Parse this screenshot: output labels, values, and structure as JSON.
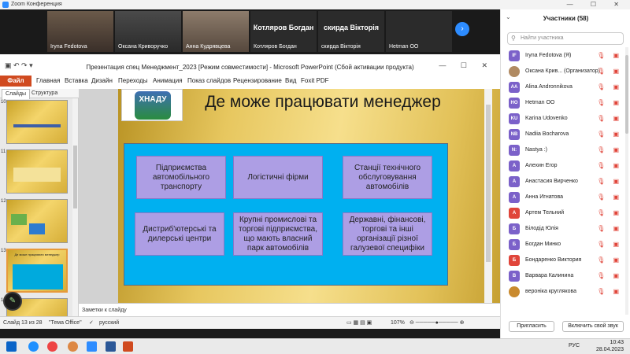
{
  "zoom": {
    "window_title": "Zoom Конференция",
    "video_tiles": [
      {
        "name": "Iryna Fedotova",
        "big": ""
      },
      {
        "name": "Оксана Криворучко",
        "big": ""
      },
      {
        "name": "Анна Кудрявцева",
        "big": ""
      },
      {
        "name": "Котляров Богдан",
        "big": "Котляров Богдан"
      },
      {
        "name": "скирда Вікторія",
        "big": "скирда Вікторія"
      },
      {
        "name": "Hetman OO",
        "big": ""
      }
    ]
  },
  "powerpoint": {
    "title": "Презентация спец Менеджмент_2023 [Режим совместимости] - Microsoft PowerPoint (Сбой активации продукта)",
    "file_tab": "Файл",
    "tabs": [
      "Главная",
      "Вставка",
      "Дизайн",
      "Переходы",
      "Анимация",
      "Показ слайдов",
      "Рецензирование",
      "Вид",
      "Foxit PDF"
    ],
    "left_tabs": [
      "Слайды",
      "Структура"
    ],
    "thumb_numbers": [
      "10",
      "11",
      "12",
      "13",
      "14"
    ],
    "thumb_titles": [
      "",
      "",
      "",
      "Де може працювати менеджер",
      ""
    ],
    "slide": {
      "logo_text": "ХНАДУ",
      "title": "Де може працювати менеджер",
      "boxes": [
        "Підприємства автомобільного транспорту",
        "Логістичні фірми",
        "Станції технічного обслуговування автомобілів",
        "Дистриб'ютерські та дилерські центри",
        "Крупні промислові та торгові підприємства, що мають власний парк автомобілів",
        "Державні, фінансові, торгові та інші організації різної галузевої специфіки"
      ]
    },
    "notes_placeholder": "Заметки к слайду",
    "status": {
      "slide_of": "Слайд 13 из 28",
      "theme": "\"Тема Office\"",
      "language": "русский",
      "zoom": "107%"
    }
  },
  "participants": {
    "header": "Участники (58)",
    "search_placeholder": "Найти участника",
    "items": [
      {
        "initials": "IF",
        "name": "Iryna Fedotova (Я)",
        "color": "#7b61c9"
      },
      {
        "initials": "",
        "name": "Оксана Крив... (Организатор)",
        "color": "#b08a62"
      },
      {
        "initials": "AA",
        "name": "Alina Andronnikova",
        "color": "#7b61c9"
      },
      {
        "initials": "HO",
        "name": "Hetman OO",
        "color": "#7b61c9"
      },
      {
        "initials": "KU",
        "name": "Karina Udovenko",
        "color": "#7b61c9"
      },
      {
        "initials": "NB",
        "name": "Nadiia Bocharova",
        "color": "#7b61c9"
      },
      {
        "initials": "N:",
        "name": "Nastya :)",
        "color": "#7b61c9"
      },
      {
        "initials": "А",
        "name": "Алехин Егор",
        "color": "#7b61c9"
      },
      {
        "initials": "А",
        "name": "Анастасия Вирченко",
        "color": "#7b61c9"
      },
      {
        "initials": "А",
        "name": "Анна Игнатова",
        "color": "#7b61c9"
      },
      {
        "initials": "А",
        "name": "Артем Тельний",
        "color": "#e0453a"
      },
      {
        "initials": "Б",
        "name": "Білодід Юлія",
        "color": "#7b61c9"
      },
      {
        "initials": "Б",
        "name": "Богдан Минко",
        "color": "#7b61c9"
      },
      {
        "initials": "Б",
        "name": "Бондаренко Виктория",
        "color": "#e0453a"
      },
      {
        "initials": "В",
        "name": "Варвара Калинина",
        "color": "#7b61c9"
      },
      {
        "initials": "",
        "name": "вероніка круглякова",
        "color": "#c98a2e"
      }
    ],
    "invite_label": "Пригласить",
    "unmute_label": "Включить свой звук"
  },
  "taskbar": {
    "lang": "РУС",
    "time": "10:43",
    "date": "28.04.2023"
  }
}
